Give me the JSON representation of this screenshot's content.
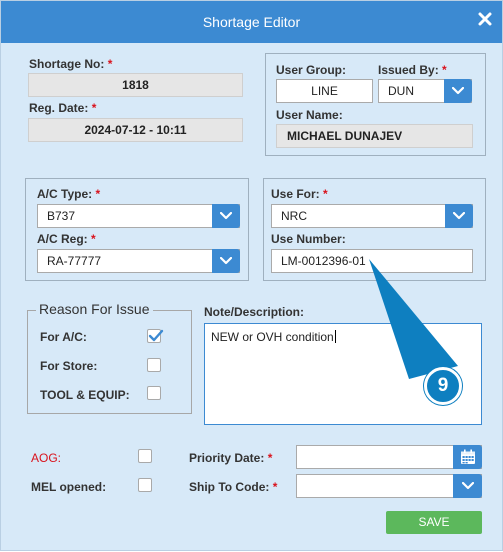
{
  "dialog": {
    "title": "Shortage Editor"
  },
  "header": {
    "shortage_no_label": "Shortage No:",
    "shortage_no_value": "1818",
    "reg_date_label": "Reg. Date:",
    "reg_date_value": "2024-07-12 - 10:11",
    "required_mark": "*"
  },
  "user": {
    "group_label": "User Group:",
    "group_value": "LINE",
    "issued_by_label": "Issued By:",
    "issued_by_value": "DUN",
    "name_label": "User Name:",
    "name_value": "MICHAEL DUNAJEV"
  },
  "aircraft": {
    "type_label": "A/C Type:",
    "type_value": "B737",
    "reg_label": "A/C Reg:",
    "reg_value": "RA-77777"
  },
  "use": {
    "for_label": "Use For:",
    "for_value": "NRC",
    "number_label": "Use Number:",
    "number_value": "LM-0012396-01"
  },
  "reason": {
    "legend": "Reason For Issue",
    "for_ac_label": "For A/C:",
    "for_ac_checked": true,
    "for_store_label": "For Store:",
    "for_store_checked": false,
    "tool_equip_label": "TOOL & EQUIP:",
    "tool_equip_checked": false
  },
  "note": {
    "label": "Note/Description:",
    "value": "NEW or OVH condition"
  },
  "footer": {
    "aog_label": "AOG:",
    "mel_label": "MEL opened:",
    "priority_date_label": "Priority Date:",
    "priority_date_value": "",
    "ship_to_label": "Ship To Code:",
    "ship_to_value": "",
    "save_label": "SAVE"
  },
  "callout": {
    "number": "9",
    "color": "#0e7fc0"
  },
  "colors": {
    "titlebar": "#3c8ad2",
    "background": "#d7e9f8",
    "required": "#d9121c",
    "save_button": "#5cb85c"
  }
}
